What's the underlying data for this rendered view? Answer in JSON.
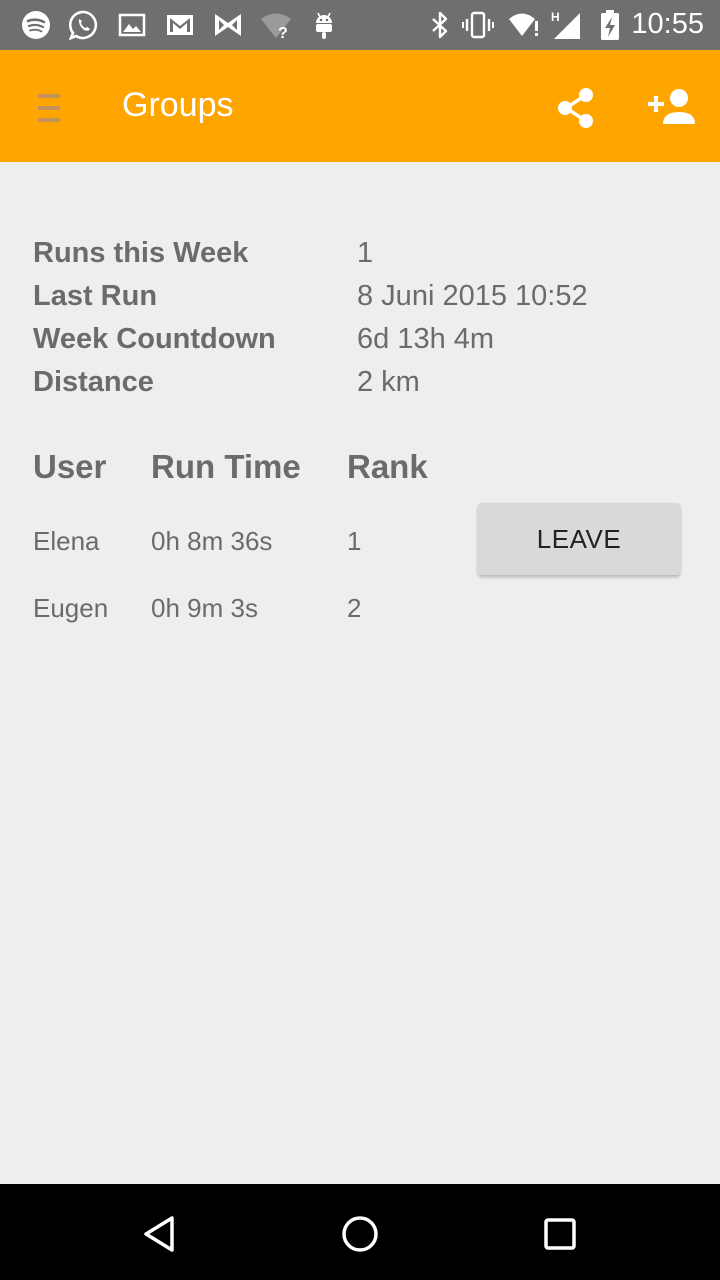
{
  "status_bar": {
    "time": "10:55",
    "left_icons": [
      "spotify-icon",
      "whatsapp-icon",
      "gallery-icon",
      "gmail-icon",
      "bow-icon",
      "wifi-question-icon",
      "android-icon"
    ],
    "right_icons": [
      "bluetooth-icon",
      "vibrate-icon",
      "wifi-alert-icon",
      "signal-h-icon",
      "battery-charging-icon"
    ]
  },
  "app_bar": {
    "title": "Groups",
    "background_color": "#ffa500",
    "menu_icon": "hamburger-menu-icon",
    "share_icon": "share-icon",
    "add_user_icon": "add-person-icon"
  },
  "stats": [
    {
      "label": "Runs this Week",
      "value": "1"
    },
    {
      "label": "Last Run",
      "value": "8 Juni 2015 10:52"
    },
    {
      "label": "Week Countdown",
      "value": "6d 13h 4m"
    },
    {
      "label": "Distance",
      "value": "2 km"
    }
  ],
  "table": {
    "headers": {
      "user": "User",
      "run_time": "Run Time",
      "rank": "Rank"
    },
    "rows": [
      {
        "user": "Elena",
        "run_time": "0h 8m 36s",
        "rank": "1"
      },
      {
        "user": "Eugen",
        "run_time": "0h 9m 3s",
        "rank": "2"
      }
    ]
  },
  "leave_button": {
    "label": "LEAVE"
  },
  "nav_bar": {
    "back_icon": "back-triangle-icon",
    "home_icon": "home-circle-icon",
    "recents_icon": "recents-square-icon"
  }
}
